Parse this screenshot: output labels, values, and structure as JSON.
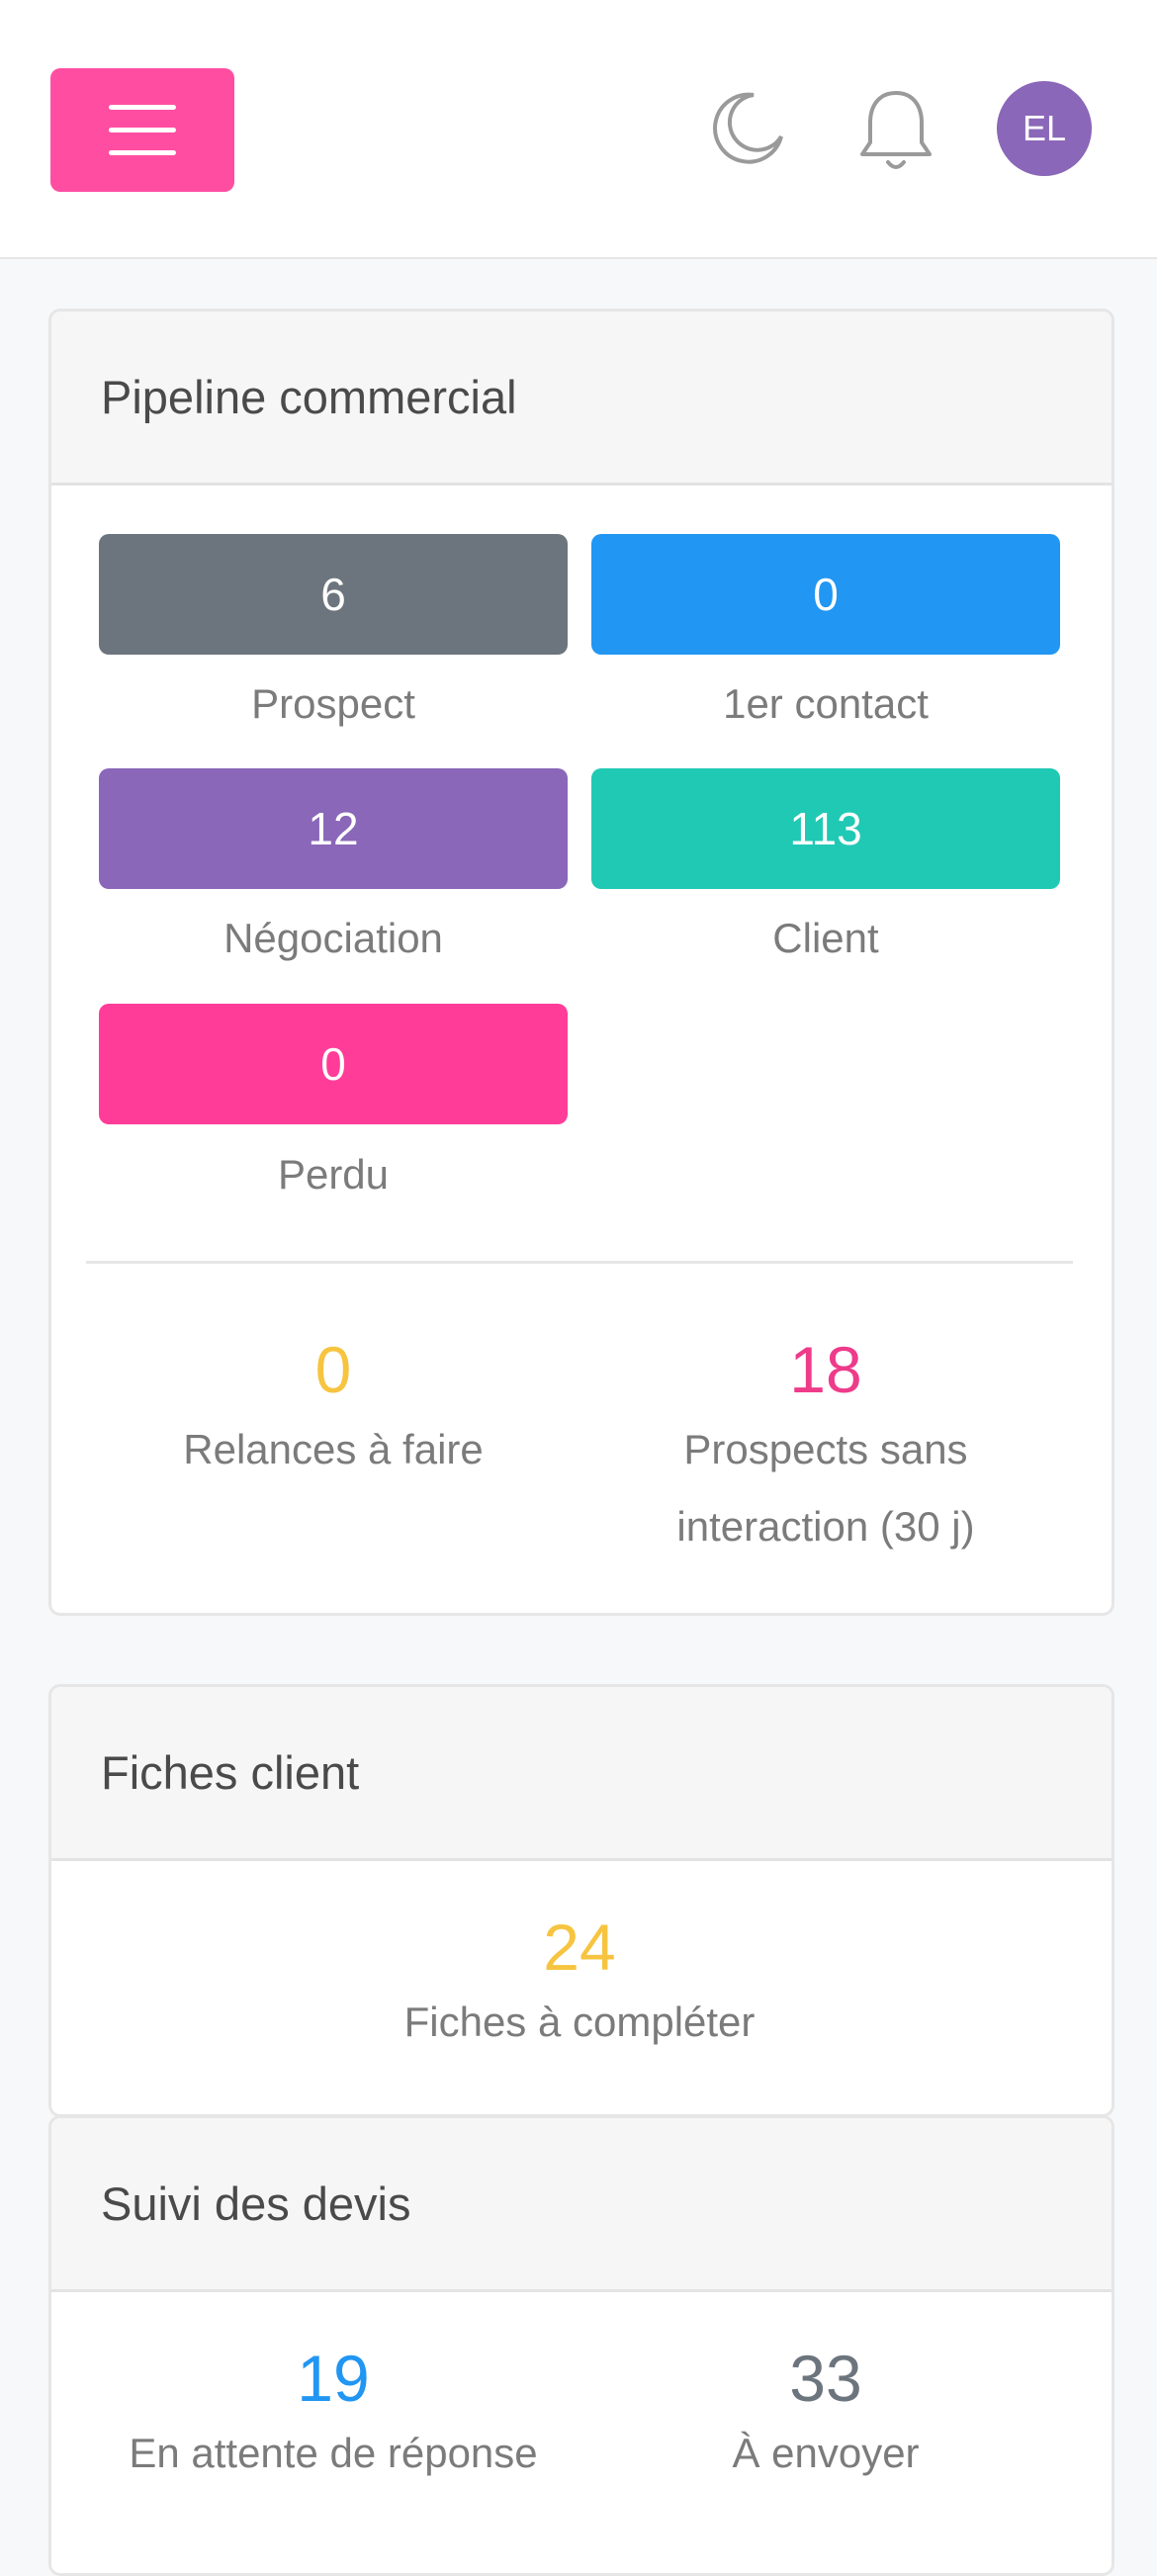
{
  "topbar": {
    "avatar_initials": "EL",
    "accent_color": "#ff4ea1"
  },
  "pipeline": {
    "title": "Pipeline commercial",
    "stages": [
      {
        "label": "Prospect",
        "count": "6",
        "color": "#6c757d"
      },
      {
        "label": "1er contact",
        "count": "0",
        "color": "#2196f3"
      },
      {
        "label": "Négociation",
        "count": "12",
        "color": "#8a67b8"
      },
      {
        "label": "Client",
        "count": "113",
        "color": "#20c9b4"
      },
      {
        "label": "Perdu",
        "count": "0",
        "color": "#ff3d98"
      }
    ],
    "relances": {
      "value": "0",
      "label": "Relances à faire",
      "color": "#f6c440"
    },
    "sans_interaction": {
      "value": "18",
      "label": "Prospects sans interaction (30 j)",
      "color": "#ee3b8a"
    }
  },
  "fiches": {
    "title": "Fiches client",
    "value": "24",
    "label": "Fiches à compléter",
    "color": "#f6c440"
  },
  "devis": {
    "title": "Suivi des devis",
    "attente": {
      "value": "19",
      "label": "En attente de réponse",
      "color": "#2196f3"
    },
    "envoyer": {
      "value": "33",
      "label": "À envoyer",
      "color": "#6c757d"
    }
  }
}
